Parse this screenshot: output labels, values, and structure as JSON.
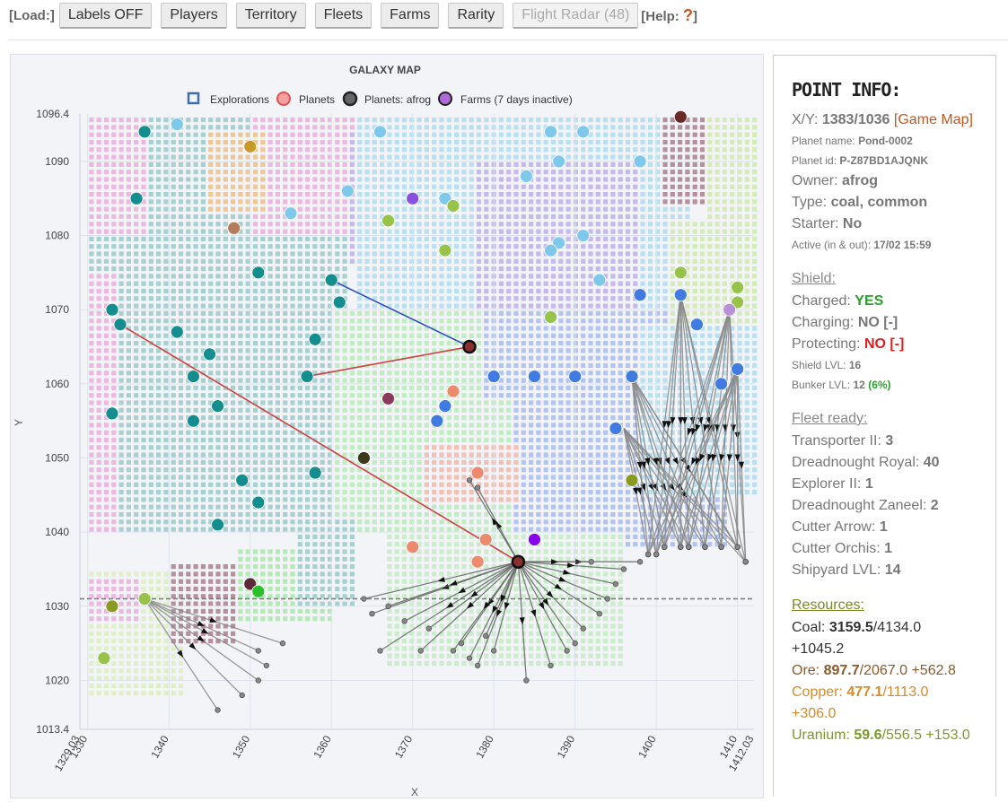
{
  "toolbar": {
    "load_label": "[Load:]",
    "buttons": [
      "Labels OFF",
      "Players",
      "Territory",
      "Fleets",
      "Farms",
      "Rarity"
    ],
    "flight_radar": "Flight Radar (48)",
    "help_label": "[Help:",
    "help_mark": "?",
    "help_close": "]"
  },
  "chart_data": {
    "type": "scatter",
    "title": "GALAXY MAP",
    "xlabel": "X",
    "ylabel": "Y",
    "xlim": [
      1329.03,
      1412.03
    ],
    "ylim": [
      1013.4,
      1096.4
    ],
    "x_ticks": [
      "1329.03",
      "1330",
      "1340",
      "1350",
      "1360",
      "1370",
      "1380",
      "1390",
      "1400",
      "1410",
      "1412.03"
    ],
    "y_ticks": [
      "1096.4",
      "1090",
      "1080",
      "1070",
      "1060",
      "1050",
      "1040",
      "1030",
      "1020",
      "1013.4"
    ],
    "legend": [
      "Explorations",
      "Planets",
      "Planets: afrog",
      "Farms (7 days inactive)"
    ],
    "legend_position": "top",
    "colors": {
      "teal": "#138d8d",
      "lightblue": "#7ec8ec",
      "blue": "#3f7be0",
      "lime": "#98c34a",
      "salmon": "#ec8a6e",
      "purple": "#8a4fe0",
      "maroon": "#5a2a3a",
      "darkmaroon": "#6b2a2a"
    },
    "series": [
      {
        "name": "Planets",
        "points": [
          {
            "x": 1337,
            "y": 1094,
            "c": "teal"
          },
          {
            "x": 1336,
            "y": 1085,
            "c": "teal"
          },
          {
            "x": 1351,
            "y": 1075,
            "c": "teal"
          },
          {
            "x": 1333,
            "y": 1070,
            "c": "teal"
          },
          {
            "x": 1334,
            "y": 1068,
            "c": "teal"
          },
          {
            "x": 1341,
            "y": 1067,
            "c": "teal"
          },
          {
            "x": 1345,
            "y": 1064,
            "c": "teal"
          },
          {
            "x": 1343,
            "y": 1061,
            "c": "teal"
          },
          {
            "x": 1333,
            "y": 1056,
            "c": "teal"
          },
          {
            "x": 1343,
            "y": 1055,
            "c": "teal"
          },
          {
            "x": 1346,
            "y": 1057,
            "c": "teal"
          },
          {
            "x": 1360,
            "y": 1074,
            "c": "teal"
          },
          {
            "x": 1361,
            "y": 1071,
            "c": "teal"
          },
          {
            "x": 1358,
            "y": 1066,
            "c": "teal"
          },
          {
            "x": 1357,
            "y": 1061,
            "c": "teal"
          },
          {
            "x": 1349,
            "y": 1047,
            "c": "teal"
          },
          {
            "x": 1358,
            "y": 1048,
            "c": "teal"
          },
          {
            "x": 1351,
            "y": 1044,
            "c": "teal"
          },
          {
            "x": 1346,
            "y": 1041,
            "c": "teal"
          },
          {
            "x": 1341,
            "y": 1095,
            "c": "lightblue"
          },
          {
            "x": 1366,
            "y": 1094,
            "c": "lightblue"
          },
          {
            "x": 1387,
            "y": 1094,
            "c": "lightblue"
          },
          {
            "x": 1391,
            "y": 1094,
            "c": "lightblue"
          },
          {
            "x": 1388,
            "y": 1090,
            "c": "lightblue"
          },
          {
            "x": 1398,
            "y": 1090,
            "c": "lightblue"
          },
          {
            "x": 1384,
            "y": 1088,
            "c": "lightblue"
          },
          {
            "x": 1362,
            "y": 1086,
            "c": "lightblue"
          },
          {
            "x": 1374,
            "y": 1085,
            "c": "lightblue"
          },
          {
            "x": 1355,
            "y": 1083,
            "c": "lightblue"
          },
          {
            "x": 1391,
            "y": 1080,
            "c": "lightblue"
          },
          {
            "x": 1388,
            "y": 1079,
            "c": "lightblue"
          },
          {
            "x": 1387,
            "y": 1078,
            "c": "lightblue"
          },
          {
            "x": 1393,
            "y": 1074,
            "c": "lightblue"
          },
          {
            "x": 1398,
            "y": 1072,
            "c": "blue"
          },
          {
            "x": 1403,
            "y": 1072,
            "c": "blue"
          },
          {
            "x": 1405,
            "y": 1068,
            "c": "blue"
          },
          {
            "x": 1380,
            "y": 1061,
            "c": "blue"
          },
          {
            "x": 1385,
            "y": 1061,
            "c": "blue"
          },
          {
            "x": 1390,
            "y": 1061,
            "c": "blue"
          },
          {
            "x": 1397,
            "y": 1061,
            "c": "blue"
          },
          {
            "x": 1410,
            "y": 1062,
            "c": "blue"
          },
          {
            "x": 1408,
            "y": 1060,
            "c": "blue"
          },
          {
            "x": 1374,
            "y": 1057,
            "c": "blue"
          },
          {
            "x": 1373,
            "y": 1055,
            "c": "blue"
          },
          {
            "x": 1395,
            "y": 1054,
            "c": "blue"
          },
          {
            "x": 1403,
            "y": 1075,
            "c": "lime"
          },
          {
            "x": 1410,
            "y": 1073,
            "c": "lime"
          },
          {
            "x": 1410,
            "y": 1071,
            "c": "lime"
          },
          {
            "x": 1367,
            "y": 1082,
            "c": "lime"
          },
          {
            "x": 1375,
            "y": 1084,
            "c": "lime"
          },
          {
            "x": 1374,
            "y": 1078,
            "c": "lime"
          },
          {
            "x": 1387,
            "y": 1069,
            "c": "lime"
          },
          {
            "x": 1397,
            "y": 1047,
            "c": "olive"
          },
          {
            "x": 1333,
            "y": 1030,
            "c": "olive"
          },
          {
            "x": 1337,
            "y": 1031,
            "c": "lime"
          },
          {
            "x": 1332,
            "y": 1023,
            "c": "lime"
          },
          {
            "x": 1348,
            "y": 1081,
            "c": "brownish"
          },
          {
            "x": 1350,
            "y": 1092,
            "c": "gold"
          },
          {
            "x": 1370,
            "y": 1085,
            "c": "purple"
          },
          {
            "x": 1385,
            "y": 1039,
            "c": "purplebright"
          },
          {
            "x": 1409,
            "y": 1070,
            "c": "lavender"
          },
          {
            "x": 1403,
            "y": 1096,
            "c": "darkmaroon"
          },
          {
            "x": 1367,
            "y": 1058,
            "c": "plum"
          },
          {
            "x": 1364,
            "y": 1050,
            "c": "darkolive"
          },
          {
            "x": 1350,
            "y": 1033,
            "c": "maroon"
          },
          {
            "x": 1351,
            "y": 1032,
            "c": "green"
          },
          {
            "x": 1375,
            "y": 1059,
            "c": "salmon"
          },
          {
            "x": 1378,
            "y": 1048,
            "c": "salmon"
          },
          {
            "x": 1370,
            "y": 1038,
            "c": "salmon"
          },
          {
            "x": 1379,
            "y": 1039,
            "c": "salmon"
          },
          {
            "x": 1378,
            "y": 1036,
            "c": "salmon"
          }
        ]
      },
      {
        "name": "Planets: afrog",
        "points": [
          {
            "x": 1377,
            "y": 1065
          },
          {
            "x": 1383,
            "y": 1036
          }
        ]
      }
    ]
  },
  "info": {
    "title": "POINT INFO:",
    "xy_label": "X/Y:",
    "xy_value": "1383/1036",
    "game_map_link": "[Game Map]",
    "planet_name_label": "Planet name:",
    "planet_name": "Pond-0002",
    "planet_id_label": "Planet id:",
    "planet_id": "P-Z87BD1AJQNK",
    "owner_label": "Owner:",
    "owner": "afrog",
    "type_label": "Type:",
    "type": "coal, common",
    "starter_label": "Starter:",
    "starter": "No",
    "active_label": "Active (in & out):",
    "active": "17/02 15:59",
    "shield_header": "Shield:",
    "charged_label": "Charged:",
    "charged": "YES",
    "charging_label": "Charging:",
    "charging": "NO [-]",
    "protecting_label": "Protecting:",
    "protecting": "NO [-]",
    "shield_lvl_label": "Shield LVL:",
    "shield_lvl": "16",
    "bunker_lvl_label": "Bunker LVL:",
    "bunker_lvl": "12",
    "bunker_pct": "(6%)",
    "fleet_header": "Fleet ready:",
    "fleet": [
      {
        "name": "Transporter II:",
        "count": "3"
      },
      {
        "name": "Dreadnought Royal:",
        "count": "40"
      },
      {
        "name": "Explorer II:",
        "count": "1"
      },
      {
        "name": "Dreadnought Zaneel:",
        "count": "2"
      },
      {
        "name": "Cutter Arrow:",
        "count": "1"
      },
      {
        "name": "Cutter Orchis:",
        "count": "1"
      },
      {
        "name": "Shipyard LVL:",
        "count": "14"
      }
    ],
    "resources_header": "Resources:",
    "coal_label": "Coal:",
    "coal_value": "3159.5",
    "coal_rest": "/4134.0",
    "coal_rate": "+1045.2",
    "ore_label": "Ore:",
    "ore_value": "897.7",
    "ore_rest": "/2067.0 +562.8",
    "copper_label": "Copper:",
    "copper_value": "477.1",
    "copper_rest": "/1113.0",
    "copper_rate": "+306.0",
    "uranium_label": "Uranium:",
    "uranium_value": "59.6",
    "uranium_rest": "/556.5 +153.0"
  }
}
